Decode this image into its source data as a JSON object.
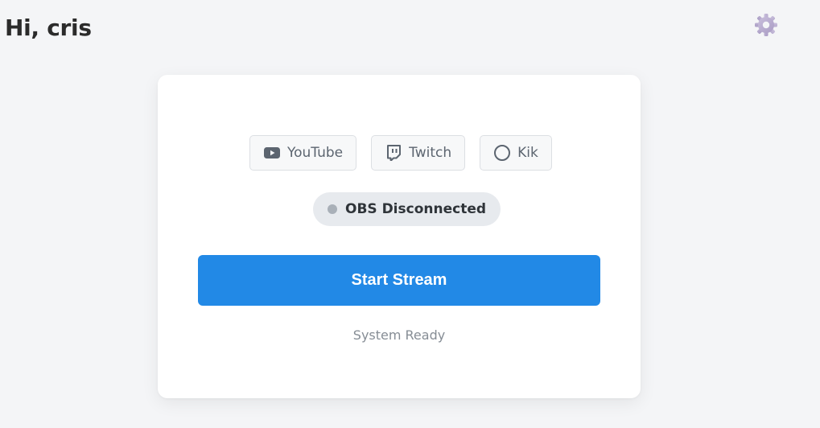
{
  "header": {
    "greeting": "Hi, cris",
    "settings_icon": "gear-icon"
  },
  "platforms": [
    {
      "label": "YouTube",
      "icon": "youtube-icon"
    },
    {
      "label": "Twitch",
      "icon": "twitch-icon"
    },
    {
      "label": "Kik",
      "icon": "circle-icon"
    }
  ],
  "obs": {
    "status_label": "OBS Disconnected",
    "dot_color": "#a9b0b8"
  },
  "stream": {
    "start_label": "Start Stream",
    "button_color": "#2289e6"
  },
  "system": {
    "status_text": "System Ready"
  }
}
